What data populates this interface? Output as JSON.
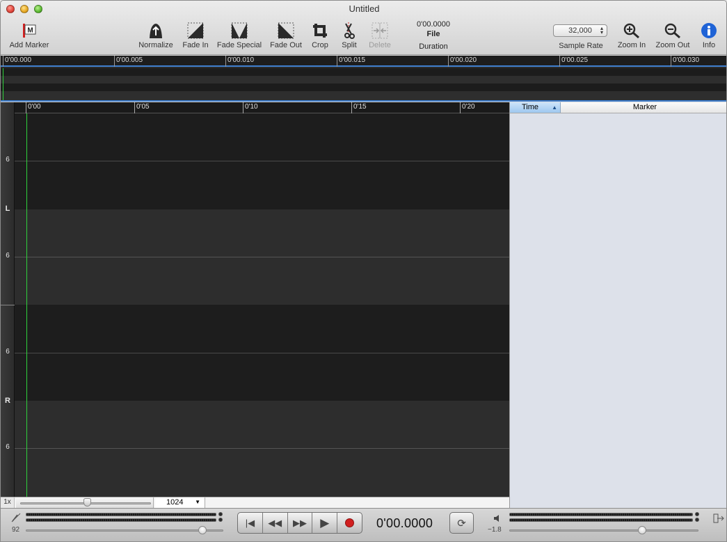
{
  "window": {
    "title": "Untitled"
  },
  "toolbar": {
    "add_marker": "Add Marker",
    "normalize": "Normalize",
    "fade_in": "Fade In",
    "fade_special": "Fade Special",
    "fade_out": "Fade Out",
    "crop": "Crop",
    "split": "Split",
    "delete": "Delete",
    "duration_value": "0'00.0000",
    "duration_source": "File",
    "duration_label": "Duration",
    "sample_rate_value": "32,000",
    "sample_rate_label": "Sample Rate",
    "zoom_in": "Zoom In",
    "zoom_out": "Zoom Out",
    "info": "Info"
  },
  "overview": {
    "ticks": [
      "0'00.000",
      "0'00.005",
      "0'00.010",
      "0'00.015",
      "0'00.020",
      "0'00.025",
      "0'00.030"
    ]
  },
  "waveform": {
    "ruler_ticks": [
      "0'00",
      "0'05",
      "0'10",
      "0'15",
      "0'20"
    ],
    "scale_labels": {
      "top": "6",
      "left_channel": "L",
      "mid": "6",
      "lower": "6",
      "right_channel": "R",
      "bottom": "6"
    }
  },
  "zoom": {
    "factor": "1x",
    "block_size": "1024"
  },
  "markers": {
    "col_time": "Time",
    "col_marker": "Marker"
  },
  "transport": {
    "time": "0'00.0000",
    "input_level": "92",
    "output_level": "−1.8"
  }
}
